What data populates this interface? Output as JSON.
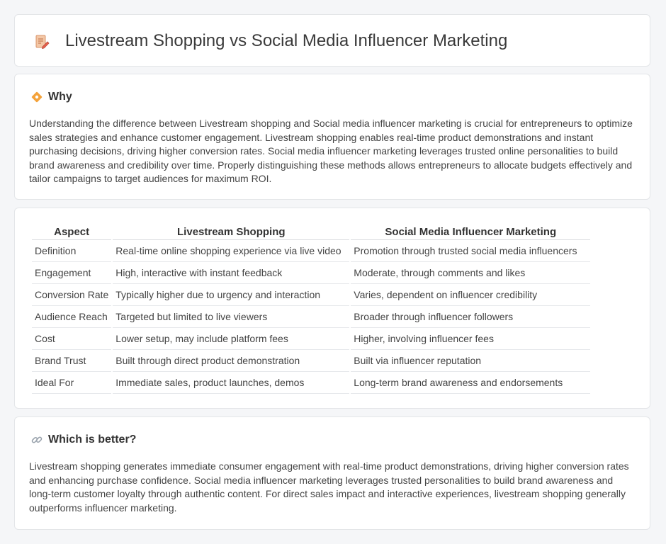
{
  "page": {
    "title": "Livestream Shopping vs Social Media Influencer Marketing",
    "title_icon": "memo-pencil-icon"
  },
  "why": {
    "heading": "Why",
    "icon": "diamond-icon",
    "text": "Understanding the difference between Livestream shopping and Social media influencer marketing is crucial for entrepreneurs to optimize sales strategies and enhance customer engagement. Livestream shopping enables real-time product demonstrations and instant purchasing decisions, driving higher conversion rates. Social media influencer marketing leverages trusted online personalities to build brand awareness and credibility over time. Properly distinguishing these methods allows entrepreneurs to allocate budgets effectively and tailor campaigns to target audiences for maximum ROI."
  },
  "comparison": {
    "headers": [
      "Aspect",
      "Livestream Shopping",
      "Social Media Influencer Marketing"
    ],
    "rows": [
      [
        "Definition",
        "Real-time online shopping experience via live video",
        "Promotion through trusted social media influencers"
      ],
      [
        "Engagement",
        "High, interactive with instant feedback",
        "Moderate, through comments and likes"
      ],
      [
        "Conversion Rate",
        "Typically higher due to urgency and interaction",
        "Varies, dependent on influencer credibility"
      ],
      [
        "Audience Reach",
        "Targeted but limited to live viewers",
        "Broader through influencer followers"
      ],
      [
        "Cost",
        "Lower setup, may include platform fees",
        "Higher, involving influencer fees"
      ],
      [
        "Brand Trust",
        "Built through direct product demonstration",
        "Built via influencer reputation"
      ],
      [
        "Ideal For",
        "Immediate sales, product launches, demos",
        "Long-term brand awareness and endorsements"
      ]
    ]
  },
  "better": {
    "heading": "Which is better?",
    "icon": "link-icon",
    "text": "Livestream shopping generates immediate consumer engagement with real-time product demonstrations, driving higher conversion rates and enhancing purchase confidence. Social media influencer marketing leverages trusted personalities to build brand awareness and long-term customer loyalty through authentic content. For direct sales impact and interactive experiences, livestream shopping generally outperforms influencer marketing."
  },
  "colors": {
    "page_background": "#f5f6f8",
    "card_background": "#ffffff",
    "card_border": "#e3e5e8",
    "diamond_orange": "#f4a23a"
  }
}
